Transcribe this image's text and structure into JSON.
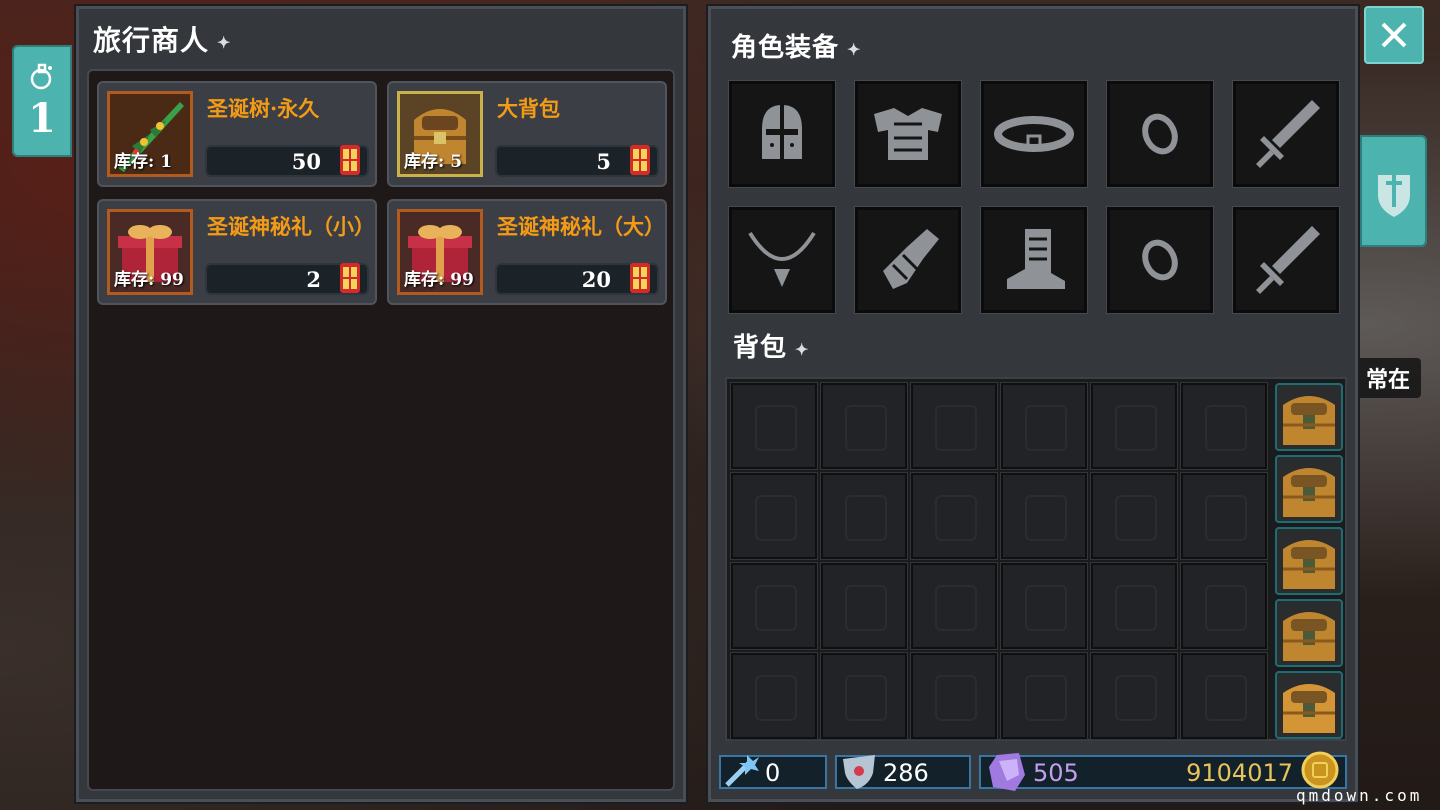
{
  "left_tab": {
    "count": "1"
  },
  "status_tag": "常在",
  "merchant": {
    "title": "旅行商人",
    "title_mark": "✦",
    "items": [
      {
        "name": "圣诞树·永久",
        "stock": "库存: 1",
        "price": "50",
        "icon": "christmas-tree-sword-icon"
      },
      {
        "name": "大背包",
        "stock": "库存: 5",
        "price": "5",
        "icon": "big-backpack-icon"
      },
      {
        "name": "圣诞神秘礼（小）",
        "stock": "库存: 99",
        "price": "2",
        "icon": "gift-box-icon"
      },
      {
        "name": "圣诞神秘礼（大）",
        "stock": "库存: 99",
        "price": "20",
        "icon": "gift-box-icon"
      }
    ]
  },
  "equipment": {
    "title": "角色装备",
    "title_mark": "✦",
    "slots": [
      "helmet-icon",
      "armor-icon",
      "belt-icon",
      "ring-icon",
      "sword-icon",
      "necklace-icon",
      "gauntlet-icon",
      "boots-icon",
      "ring-icon",
      "sword-icon"
    ]
  },
  "bag": {
    "title": "背包",
    "title_mark": "✦"
  },
  "currency": {
    "gem_count": "0",
    "shield_count": "286",
    "crystal_count": "505",
    "gold_count": "9104017"
  },
  "watermark": "qmdown.com",
  "colors": {
    "accent": "#4db3ae",
    "item_name": "#f39a16",
    "crystal": "#c49ff0",
    "gold": "#e8c25a"
  }
}
